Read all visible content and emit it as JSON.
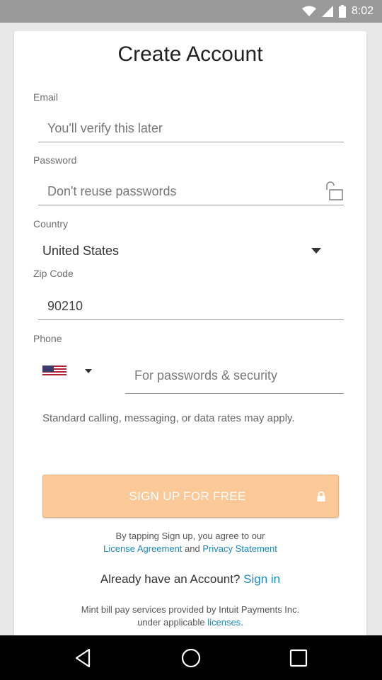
{
  "status_bar": {
    "time": "8:02",
    "icons": [
      "wifi-icon",
      "signal-icon",
      "battery-icon"
    ]
  },
  "form": {
    "title": "Create Account",
    "email": {
      "label": "Email",
      "placeholder": "You'll verify this later"
    },
    "password": {
      "label": "Password",
      "placeholder": "Don't reuse passwords",
      "toggle_icon": "lock-open-icon"
    },
    "country": {
      "label": "Country",
      "value": "United States"
    },
    "zip": {
      "label": "Zip Code",
      "value": "90210"
    },
    "phone": {
      "label": "Phone",
      "flag_icon": "us-flag-icon",
      "placeholder": "For passwords & security"
    },
    "rates_notice": "Standard calling, messaging, or data rates may apply.",
    "signup_button": {
      "label": "SIGN UP FOR FREE",
      "icon": "lock-icon",
      "color": "#fbc897"
    },
    "agreement": {
      "prefix": "By tapping Sign up, you agree to our",
      "license_link": "License Agreement",
      "and": "and",
      "privacy_link": "Privacy Statement"
    },
    "already": {
      "text": "Already have an Account?",
      "link": "Sign in"
    },
    "footer": {
      "line1": "Mint bill pay services provided by Intuit Payments Inc.",
      "line2_prefix": "under applicable",
      "licenses_link": "licenses",
      "line2_suffix": "."
    }
  },
  "colors": {
    "link": "#1b8ab8",
    "status_bar": "#9a9a9a",
    "background": "#e8e8e8"
  },
  "nav_bar": {
    "icons": [
      "back-icon",
      "home-icon",
      "recents-icon"
    ]
  }
}
